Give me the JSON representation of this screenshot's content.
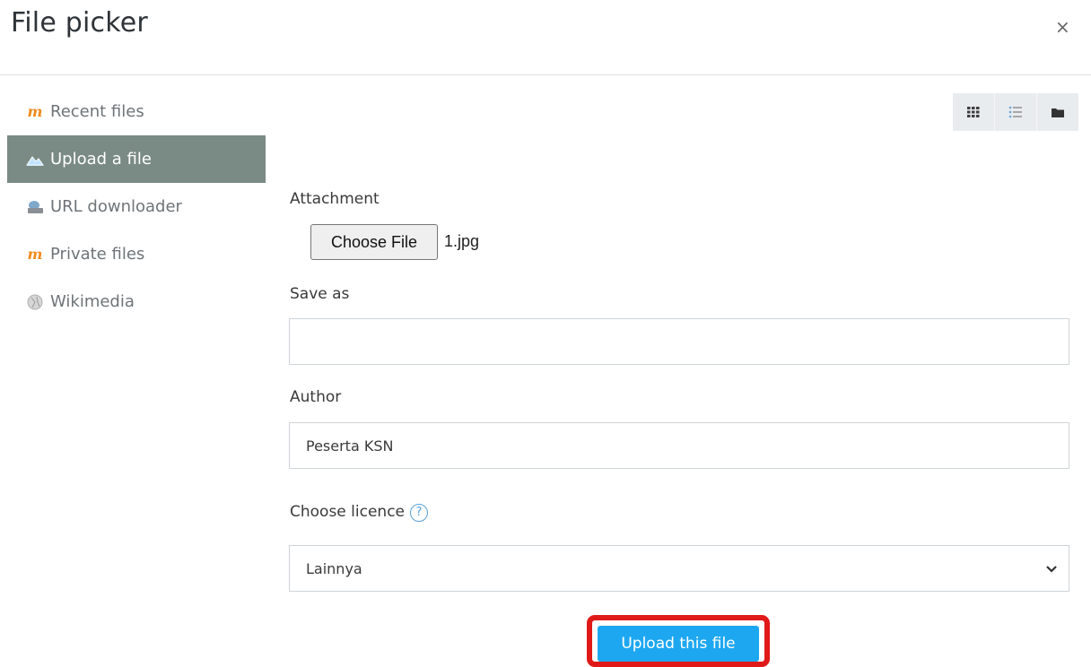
{
  "dialog": {
    "title": "File picker",
    "close_icon": "×"
  },
  "sidebar": {
    "items": [
      {
        "label": "Recent files",
        "icon": "moodle-logo-icon",
        "active": false
      },
      {
        "label": "Upload a file",
        "icon": "upload-icon",
        "active": true
      },
      {
        "label": "URL downloader",
        "icon": "url-downloader-icon",
        "active": false
      },
      {
        "label": "Private files",
        "icon": "moodle-logo-icon",
        "active": false
      },
      {
        "label": "Wikimedia",
        "icon": "wikimedia-globe-icon",
        "active": false
      }
    ],
    "active_color": "#7a8a84"
  },
  "view_toolbar": {
    "buttons": [
      "icons-view-icon",
      "list-view-icon",
      "tree-view-icon"
    ]
  },
  "form": {
    "attachment_label": "Attachment",
    "choose_file_label": "Choose File",
    "selected_file": "1.jpg",
    "save_as_label": "Save as",
    "save_as_value": "",
    "author_label": "Author",
    "author_value": "Peserta KSN",
    "licence_label": "Choose licence",
    "licence_help_icon": "?",
    "licence_value": "Lainnya"
  },
  "actions": {
    "upload_label": "Upload this file",
    "upload_color": "#1ea7f1",
    "highlight_color": "#e01919"
  }
}
